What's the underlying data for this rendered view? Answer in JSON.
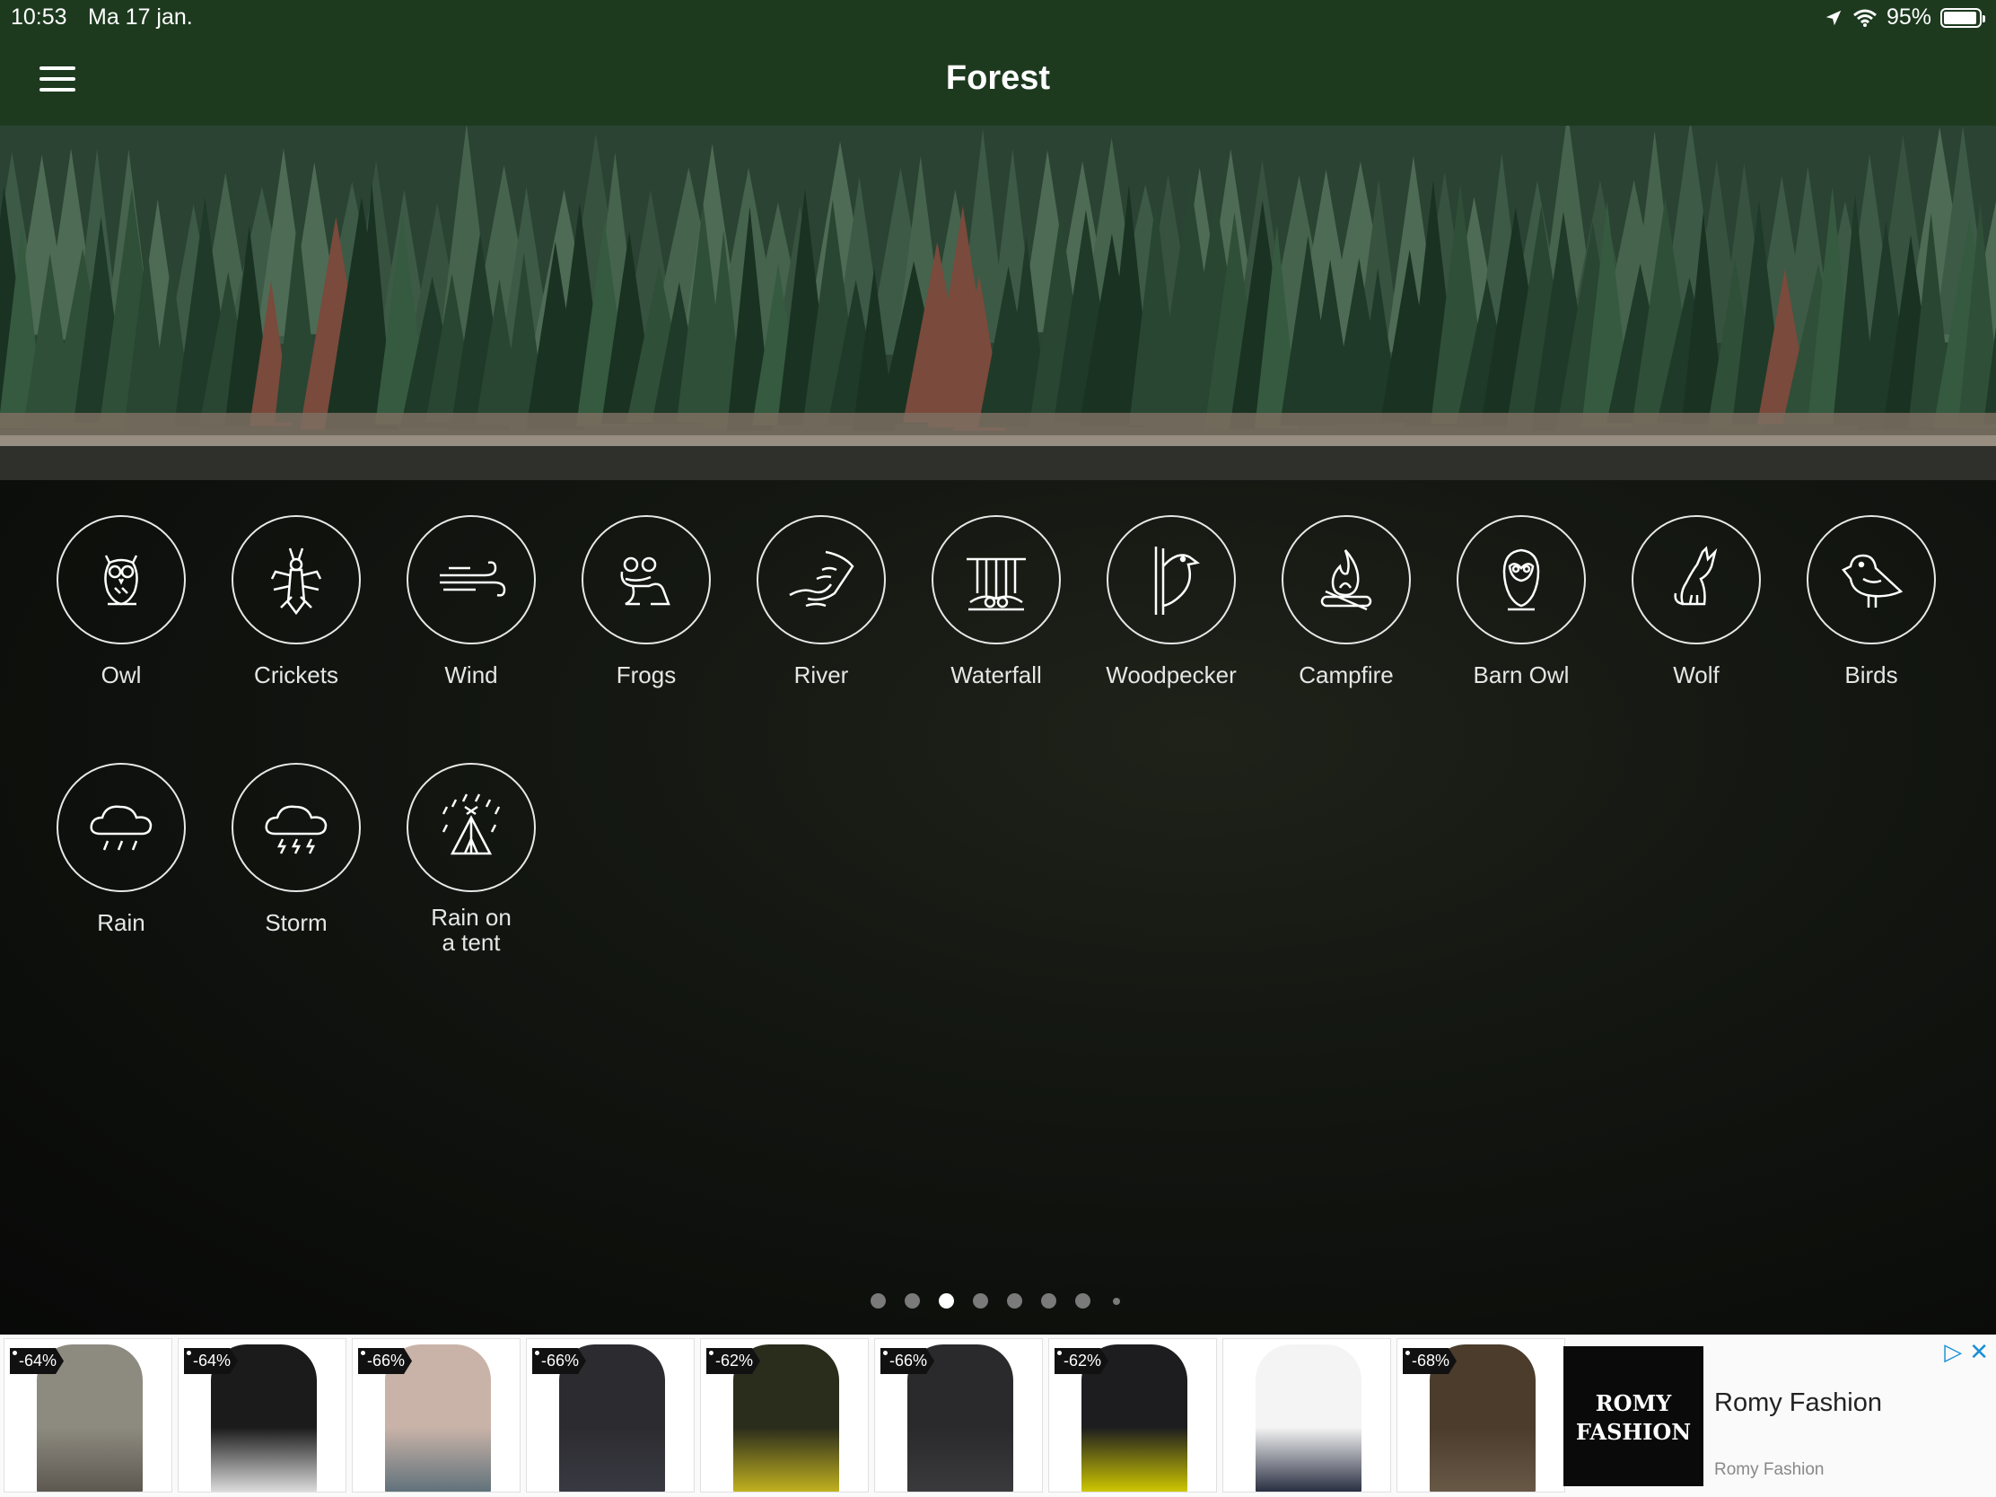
{
  "status": {
    "time": "10:53",
    "date": "Ma 17 jan.",
    "battery": "95%",
    "battery_level": 0.95
  },
  "navbar": {
    "title": "Forest",
    "menu_icon": "hamburger-menu-icon"
  },
  "sounds": [
    {
      "label": "Owl",
      "icon": "owl-icon"
    },
    {
      "label": "Crickets",
      "icon": "cricket-icon"
    },
    {
      "label": "Wind",
      "icon": "wind-icon"
    },
    {
      "label": "Frogs",
      "icon": "frog-icon"
    },
    {
      "label": "River",
      "icon": "river-icon"
    },
    {
      "label": "Waterfall",
      "icon": "waterfall-icon"
    },
    {
      "label": "Woodpecker",
      "icon": "woodpecker-icon"
    },
    {
      "label": "Campfire",
      "icon": "campfire-icon"
    },
    {
      "label": "Barn Owl",
      "icon": "barn-owl-icon"
    },
    {
      "label": "Wolf",
      "icon": "wolf-icon"
    },
    {
      "label": "Birds",
      "icon": "bird-icon"
    },
    {
      "label": "Rain",
      "icon": "rain-icon"
    },
    {
      "label": "Storm",
      "icon": "storm-icon"
    },
    {
      "label": "Rain on\na tent",
      "icon": "tent-rain-icon"
    }
  ],
  "pager": {
    "count": 8,
    "active_index": 2
  },
  "ad": {
    "discounts": [
      "-64%",
      "-64%",
      "-66%",
      "-66%",
      "-62%",
      "-66%",
      "-62%",
      "",
      "-68%"
    ],
    "brand_logo_line1": "ROMY",
    "brand_logo_line2": "FASHION",
    "brand_name": "Romy Fashion",
    "brand_sub": "Romy Fashion",
    "adchoices_icon": "adchoices-icon",
    "close_icon": "close-icon"
  },
  "colors": {
    "header": "#1d3a1f",
    "accent": "#ffffff",
    "adlink": "#1a8fd6"
  }
}
